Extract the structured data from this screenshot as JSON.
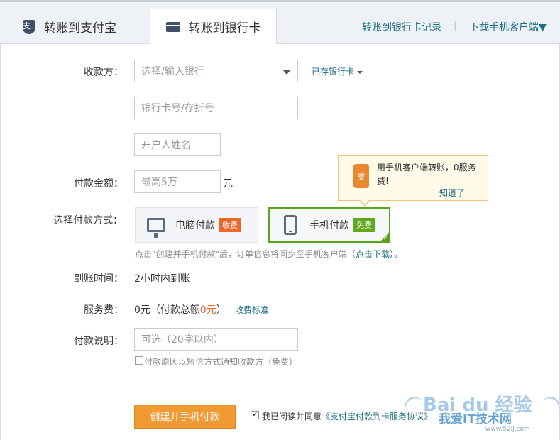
{
  "tabs": [
    {
      "label": "转账到支付宝",
      "icon": "alipay-icon",
      "active": false
    },
    {
      "label": "转账到银行卡",
      "icon": "bank-card-icon",
      "active": true
    }
  ],
  "header_links": {
    "records": "转账到银行卡记录",
    "separator": "|",
    "download": "下载手机客户端▼"
  },
  "form": {
    "payee_label": "收款方：",
    "bank_select_placeholder": "选择/输入银行",
    "saved_cards_link": "已存银行卡",
    "card_number_placeholder": "银行卡号/存折号",
    "account_name_placeholder": "开户人姓名",
    "amount_label": "付款金额：",
    "amount_placeholder": "最高5万",
    "amount_unit": "元",
    "method_label": "选择付款方式：",
    "method_pc": {
      "label": "电脑付款",
      "badge": "收费"
    },
    "method_mobile": {
      "label": "手机付款",
      "badge": "免费",
      "selected": true
    },
    "method_hint_prefix": "点击\"创建并手机付款\"后，订单信息将同步至手机客户端（",
    "method_hint_link": "点击下载",
    "method_hint_suffix": "）。",
    "arrival_label": "到账时间：",
    "arrival_value": "2小时内到账",
    "fee_label": "服务费：",
    "fee_value_prefix": "0元（付款总额",
    "fee_value_highlight": "0元",
    "fee_value_suffix": "）",
    "fee_standard_link": "收费标准",
    "note_label": "付款说明：",
    "note_placeholder": "可选（20字以内）",
    "sms_notify_label": "付款原因以短信方式通知收款方（免费）",
    "submit_label": "创建并手机付款",
    "agree_prefix": "我已阅读并同意",
    "agree_link": "《支付宝付款到卡服务协议》"
  },
  "tooltip": {
    "icon_char": "支",
    "text": "用手机客户端转账，0服务费!",
    "dismiss": "知道了"
  },
  "watermark": {
    "brand": "Bai du 经验",
    "subtitle": "我爱IT技术网",
    "url": "www.52ij.com"
  },
  "colors": {
    "link": "#1b6d85",
    "accent_orange": "#f19a33",
    "selected_green": "#5aa31c"
  }
}
